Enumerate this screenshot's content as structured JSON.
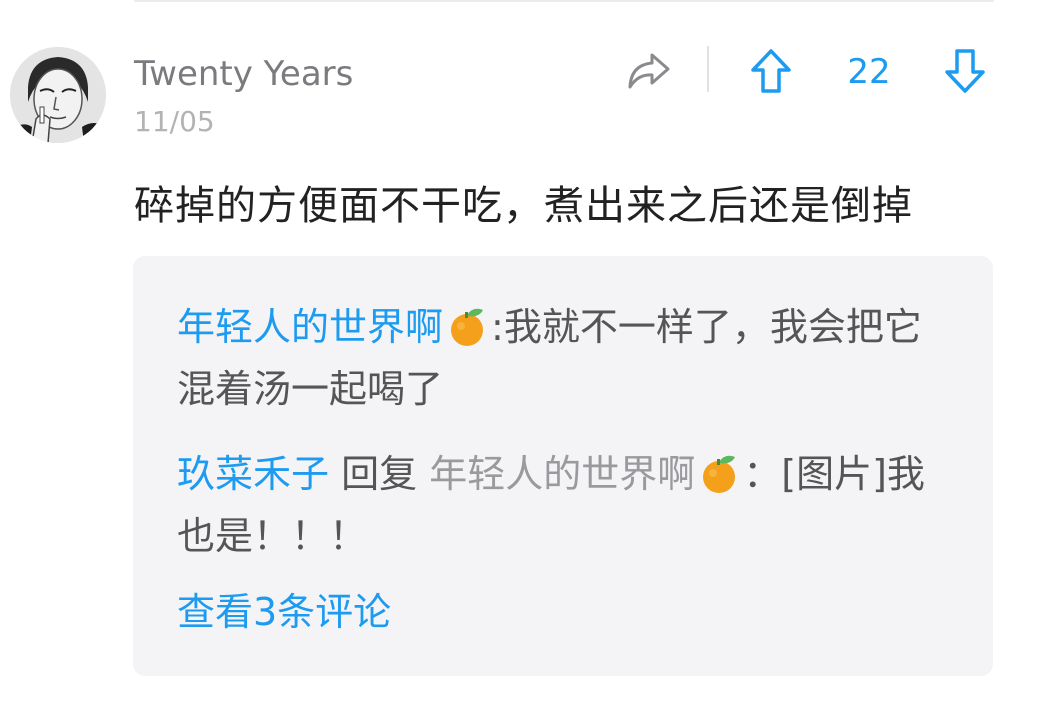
{
  "comment": {
    "username": "Twenty Years",
    "date": "11/05",
    "text": "碎掉的方便面不干吃，煮出来之后还是倒掉",
    "vote_count": "22"
  },
  "replies": [
    {
      "author": "年轻人的世界啊",
      "author_emoji": "tangerine-icon",
      "separator": ":",
      "text": "我就不一样了，我会把它混着汤一起喝了"
    },
    {
      "author": "玖菜禾子",
      "reply_label": "回复",
      "target": "年轻人的世界啊",
      "target_emoji": "tangerine-icon",
      "separator": "：",
      "text": "[图片]我也是！！！"
    }
  ],
  "view_more_label": "查看3条评论",
  "colors": {
    "accent": "#1d9bf0",
    "username": "#7b7b7f",
    "date": "#b3b3b6",
    "body_text": "#222222",
    "reply_box_bg": "#f4f4f6"
  }
}
